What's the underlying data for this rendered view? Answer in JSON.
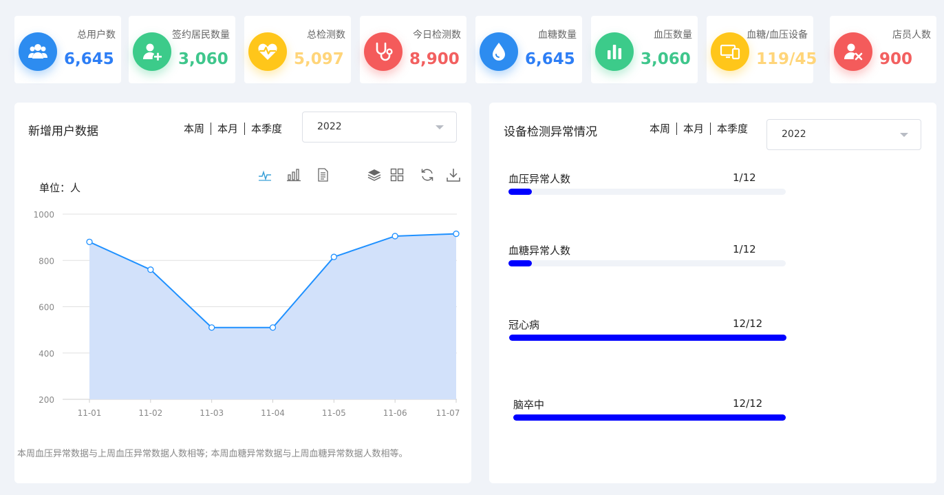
{
  "stats": [
    {
      "label": "总用户数",
      "value": "6,645",
      "color": "#2d8cf0",
      "icon": "users-icon"
    },
    {
      "label": "签约居民数量",
      "value": "3,060",
      "color": "#3ccb8a",
      "icon": "add-user-icon"
    },
    {
      "label": "总检测数",
      "value": "5,097",
      "color": "#ffc61a",
      "icon": "heart-pulse-icon"
    },
    {
      "label": "今日检测数",
      "value": "8,900",
      "color": "#f45b5b",
      "icon": "stethoscope-icon"
    },
    {
      "label": "血糖数量",
      "value": "6,645",
      "color": "#2d8cf0",
      "icon": "water-drop-icon"
    },
    {
      "label": "血压数量",
      "value": "3,060",
      "color": "#3ccb8a",
      "icon": "bar-chart-icon"
    },
    {
      "label": "血糖/血压设备",
      "value": "119/45",
      "color": "#ffc61a",
      "icon": "devices-icon"
    },
    {
      "label": "店员人数",
      "value": "900",
      "color": "#f45b5b",
      "icon": "remove-user-icon"
    }
  ],
  "stat_value_colors": [
    "#2d7ef5",
    "#3fc68c",
    "#ffd57a",
    "#f26060",
    "#2d7ef5",
    "#3fc68c",
    "#ffd57a",
    "#f26060"
  ],
  "left_panel": {
    "title": "新增用户数据",
    "periods": [
      "本周",
      "本月",
      "本季度"
    ],
    "year": "2022",
    "unit": "单位：人",
    "footnote": "本周血压异常数据与上周血压异常数据人数相等; 本周血糖异常数据与上周血糖异常数据人数相等。",
    "toolbox": [
      "line-chart-icon",
      "bar-chart-icon",
      "data-view-icon",
      "stack-icon",
      "tiled-icon",
      "restore-icon",
      "download-icon"
    ]
  },
  "chart_data": {
    "type": "area",
    "categories": [
      "11-01",
      "11-02",
      "11-03",
      "11-04",
      "11-05",
      "11-06",
      "11-07"
    ],
    "series": [
      {
        "values": [
          880,
          760,
          510,
          510,
          815,
          905,
          915
        ]
      }
    ],
    "ylim": [
      200,
      1000
    ],
    "yticks": [
      200,
      400,
      600,
      800,
      1000
    ],
    "grid": true,
    "line_color": "#1e90ff",
    "fill_color": "#d2e1fa"
  },
  "right_panel": {
    "title": "设备检测异常情况",
    "periods": [
      "本周",
      "本月",
      "本季度"
    ],
    "year": "2022",
    "items": [
      {
        "label": "血压异常人数",
        "count": "1/12",
        "ratio": 0.0833
      },
      {
        "label": "血糖异常人数",
        "count": "1/12",
        "ratio": 0.0833
      },
      {
        "label": "冠心病",
        "count": "12/12",
        "ratio": 1.0
      },
      {
        "label": "脑卒中",
        "count": "12/12",
        "ratio": 1.0
      }
    ],
    "bar_color": "#0000ff"
  }
}
